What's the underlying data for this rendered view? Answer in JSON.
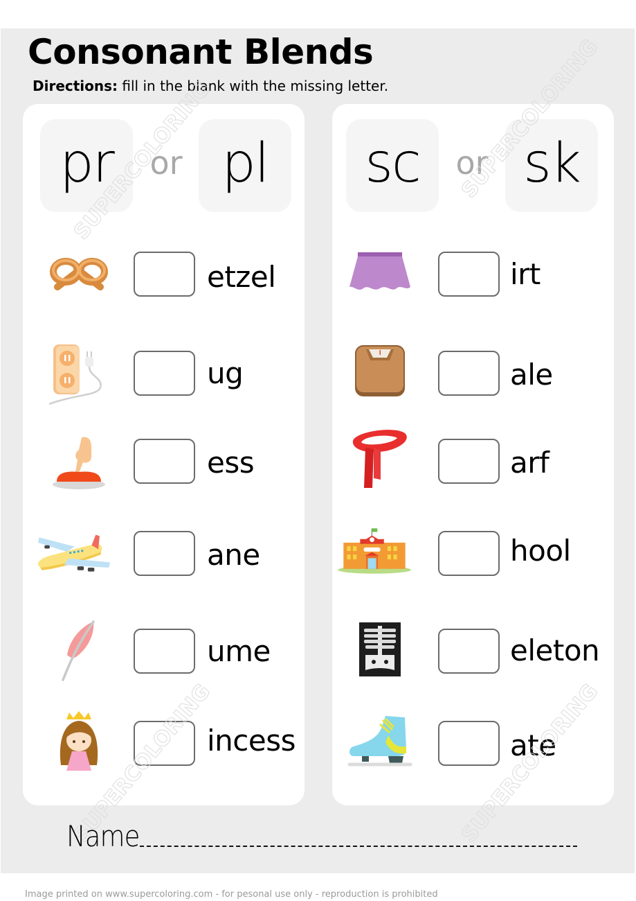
{
  "worksheet": {
    "title": "Consonant Blends",
    "directions_label": "Directions:",
    "directions_text": " fill in the blank with the missing letter.",
    "connector": "or",
    "name_label": "Name",
    "footer": "Image printed on www.supercoloring.com - for pesonal use only - reproduction is prohibited",
    "watermark": "SUPERCOLORING"
  },
  "panels": [
    {
      "blends": [
        "pr",
        "pl"
      ],
      "items": [
        {
          "picture": "pretzel-icon",
          "suffix": "etzel",
          "answer": ""
        },
        {
          "picture": "plug-icon",
          "suffix": "ug",
          "answer": ""
        },
        {
          "picture": "press-button-icon",
          "suffix": "ess",
          "answer": ""
        },
        {
          "picture": "plane-icon",
          "suffix": "ane",
          "answer": ""
        },
        {
          "picture": "plume-feather-icon",
          "suffix": "ume",
          "answer": ""
        },
        {
          "picture": "princess-icon",
          "suffix": "incess",
          "answer": ""
        }
      ]
    },
    {
      "blends": [
        "sc",
        "sk"
      ],
      "items": [
        {
          "picture": "skirt-icon",
          "suffix": "irt",
          "answer": ""
        },
        {
          "picture": "scale-icon",
          "suffix": "ale",
          "answer": ""
        },
        {
          "picture": "scarf-icon",
          "suffix": "arf",
          "answer": ""
        },
        {
          "picture": "school-icon",
          "suffix": "hool",
          "answer": ""
        },
        {
          "picture": "skeleton-xray-icon",
          "suffix": "eleton",
          "answer": ""
        },
        {
          "picture": "skate-icon",
          "suffix": "ate",
          "answer": ""
        }
      ]
    }
  ],
  "colors": {
    "sheet_background": "#ececec",
    "panel_background": "#ffffff",
    "tile_background": "#f5f5f5",
    "box_border": "#6b6b6b",
    "connector_text": "#a8a8a8",
    "footer_text": "#9a9a9a"
  }
}
